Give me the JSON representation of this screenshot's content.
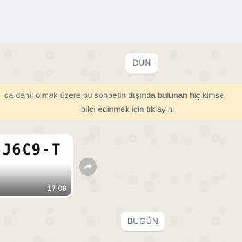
{
  "chat": {
    "date_yesterday": "DÜN",
    "notice": {
      "line1": "da dahil olmak üzere bu sohbetin dışında bulunan hiç kimse",
      "line2": "bilgi edinmek için tıklayın."
    },
    "message": {
      "image_text": "J6C9-T",
      "time": "17:09"
    },
    "date_today": "BUGÜN"
  },
  "icons": {
    "forward": "forward-arrow-icon"
  },
  "colors": {
    "background": "#efeae2",
    "notice_bg": "#ffeecd",
    "bubble_bg": "#ffffff",
    "text_secondary": "#54656f"
  }
}
